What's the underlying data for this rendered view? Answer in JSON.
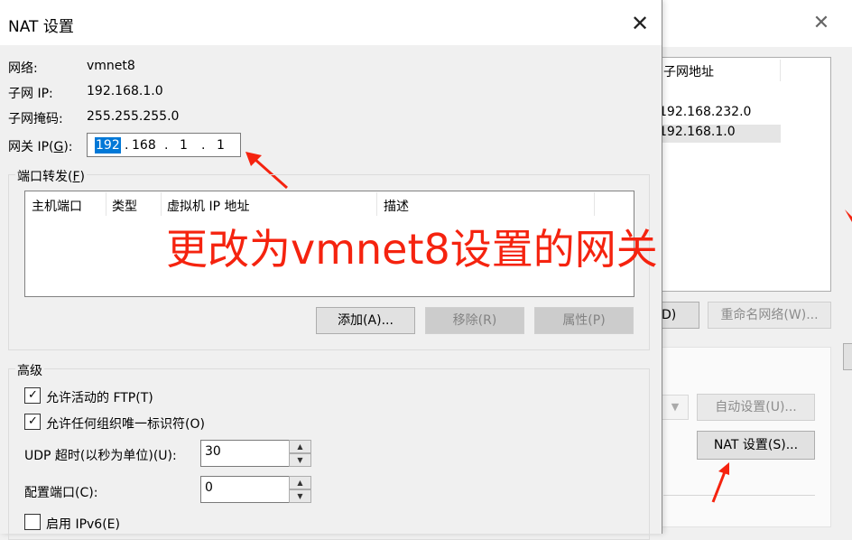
{
  "background_window": {
    "column_header": "子网地址",
    "rows": [
      "192.168.232.0",
      "192.168.1.0"
    ],
    "button_d_label": "D)",
    "button_rename_label": "重命名网络(W)...",
    "button_auto_label": "自动设置(U)...",
    "button_nat_label": "NAT 设置(S)...",
    "close_glyph": "✕"
  },
  "dialog": {
    "title": "NAT 设置",
    "close_glyph": "✕",
    "network_label": "网络:",
    "network_value": "vmnet8",
    "subnet_label": "子网 IP:",
    "subnet_value": "192.168.1.0",
    "mask_label": "子网掩码:",
    "mask_value": "255.255.255.0",
    "gateway_label_prefix": "网关 IP(",
    "gateway_label_key": "G",
    "gateway_label_suffix": "):",
    "gateway_octets": [
      "192",
      "168",
      "1",
      "1"
    ],
    "port_forwarding": {
      "legend_prefix": "端口转发(",
      "legend_key": "F",
      "legend_suffix": ")",
      "columns": [
        "主机端口",
        "类型",
        "虚拟机 IP 地址",
        "描述"
      ],
      "rows": [],
      "add_label": "添加(A)...",
      "remove_label": "移除(R)",
      "properties_label": "属性(P)"
    },
    "advanced": {
      "legend": "高级",
      "allow_ftp_label": "允许活动的 FTP(T)",
      "allow_ftp_checked": true,
      "allow_uid_label": "允许任何组织唯一标识符(O)",
      "allow_uid_checked": true,
      "udp_timeout_label": "UDP 超时(以秒为单位)(U):",
      "udp_timeout_value": "30",
      "config_port_label": "配置端口(C):",
      "config_port_value": "0",
      "enable_ipv6_label": "启用 IPv6(E)",
      "enable_ipv6_checked": false
    }
  },
  "annotation": {
    "text": "更改为vmnet8设置的网关",
    "color": "#f5230f"
  }
}
